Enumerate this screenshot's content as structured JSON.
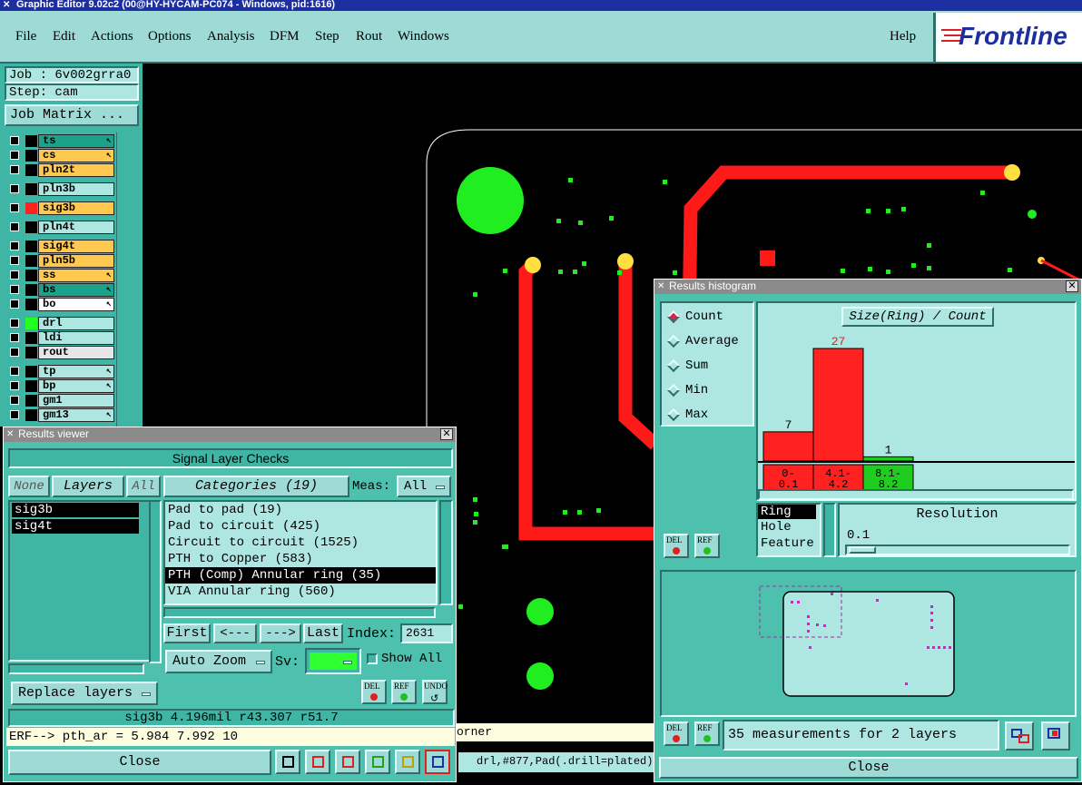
{
  "app": {
    "title": "Graphic Editor 9.02c2 (00@HY-HYCAM-PC074 - Windows, pid:1616)"
  },
  "menu": {
    "items": [
      "File",
      "Edit",
      "Actions",
      "Options",
      "Analysis",
      "DFM",
      "Step",
      "Rout",
      "Windows"
    ],
    "help": "Help",
    "logo": "Frontline"
  },
  "job": {
    "job": "Job : 6v002grra0",
    "step": "Step: cam",
    "matrix_button": "Job Matrix ..."
  },
  "layers": [
    {
      "name": "ts",
      "color": "#1aa38a",
      "arrow": true
    },
    {
      "name": "cs",
      "color": "#ffc94f",
      "arrow": true
    },
    {
      "name": "pln2t",
      "color": "#ffc94f",
      "arrow": false
    },
    {
      "name": "pln3b",
      "color": "#aee6e1",
      "arrow": false
    },
    {
      "name": "sig3b",
      "color": "#ffc94f",
      "arrow": false,
      "swatch": "#ff2020"
    },
    {
      "name": "pln4t",
      "color": "#aee6e1",
      "arrow": false
    },
    {
      "name": "sig4t",
      "color": "#ffc94f",
      "arrow": false
    },
    {
      "name": "pln5b",
      "color": "#ffc94f",
      "arrow": false
    },
    {
      "name": "ss",
      "color": "#ffc94f",
      "arrow": true
    },
    {
      "name": "bs",
      "color": "#1aa38a",
      "arrow": true
    },
    {
      "name": "bo",
      "color": "#ffffff",
      "arrow": true
    },
    {
      "name": "drl",
      "color": "#aee6e1",
      "arrow": false,
      "swatch": "#20ff20"
    },
    {
      "name": "ldi",
      "color": "#aee6e1",
      "arrow": false
    },
    {
      "name": "rout",
      "color": "#e6e6e6",
      "arrow": false
    },
    {
      "name": "tp",
      "color": "#aee6e1",
      "arrow": true
    },
    {
      "name": "bp",
      "color": "#aee6e1",
      "arrow": true
    },
    {
      "name": "gm1",
      "color": "#aee6e1",
      "arrow": false
    },
    {
      "name": "gm13",
      "color": "#aee6e1",
      "arrow": true
    }
  ],
  "results_viewer": {
    "title": "Results viewer",
    "heading": "Signal Layer Checks",
    "none": "None",
    "layers": "Layers",
    "all": "All",
    "layer_list": [
      "sig3b",
      "sig4t"
    ],
    "categories": "Categories (19)",
    "meas_label": "Meas:",
    "meas_value": "All",
    "category_list": [
      "Pad to pad (19)",
      "Pad to circuit (425)",
      "Circuit to circuit (1525)",
      "PTH to Copper (583)",
      "PTH (Comp) Annular ring (35)",
      "VIA Annular ring (560)"
    ],
    "selected_index": 4,
    "nav": {
      "first": "First",
      "prev": "<---",
      "next": "--->",
      "last": "Last",
      "index_label": "Index:",
      "index_value": "2631"
    },
    "auto_zoom": "Auto Zoom",
    "sv_label": "Sv:",
    "show_all": "Show All",
    "replace_layers": "Replace layers",
    "del": "DEL",
    "ref": "REF",
    "undo": "UNDO",
    "status": "sig3b 4.196mil  r43.307  r51.7",
    "erf": "ERF--> pth_ar = 5.984 7.992 10",
    "close": "Close"
  },
  "bottom_status": {
    "corner": "orner",
    "info": "drl,#877,Pad(.drill=plated),"
  },
  "histogram": {
    "title": "Results histogram",
    "modes": [
      "Count",
      "Average",
      "Sum",
      "Min",
      "Max"
    ],
    "selected_mode": 0,
    "chart_title": "Size(Ring) / Count",
    "resolution_label": "Resolution",
    "resolution_value": "0.1",
    "attrs": [
      "Ring",
      "Hole",
      "Feature"
    ],
    "measurements": "35 measurements for 2 layers",
    "close": "Close",
    "del": "DEL",
    "ref": "REF"
  },
  "chart_data": {
    "type": "bar",
    "title": "Size(Ring) / Count",
    "categories": [
      "0-\n0.1",
      "4.1-\n4.2",
      "8.1-\n8.2"
    ],
    "category_lines": [
      [
        "0-",
        "0.1"
      ],
      [
        "4.1-",
        "4.2"
      ],
      [
        "8.1-",
        "8.2"
      ]
    ],
    "values": [
      7,
      27,
      1
    ],
    "colors": [
      "#ff2020",
      "#ff2020",
      "#20cc20"
    ],
    "ylim": [
      0,
      27
    ]
  }
}
